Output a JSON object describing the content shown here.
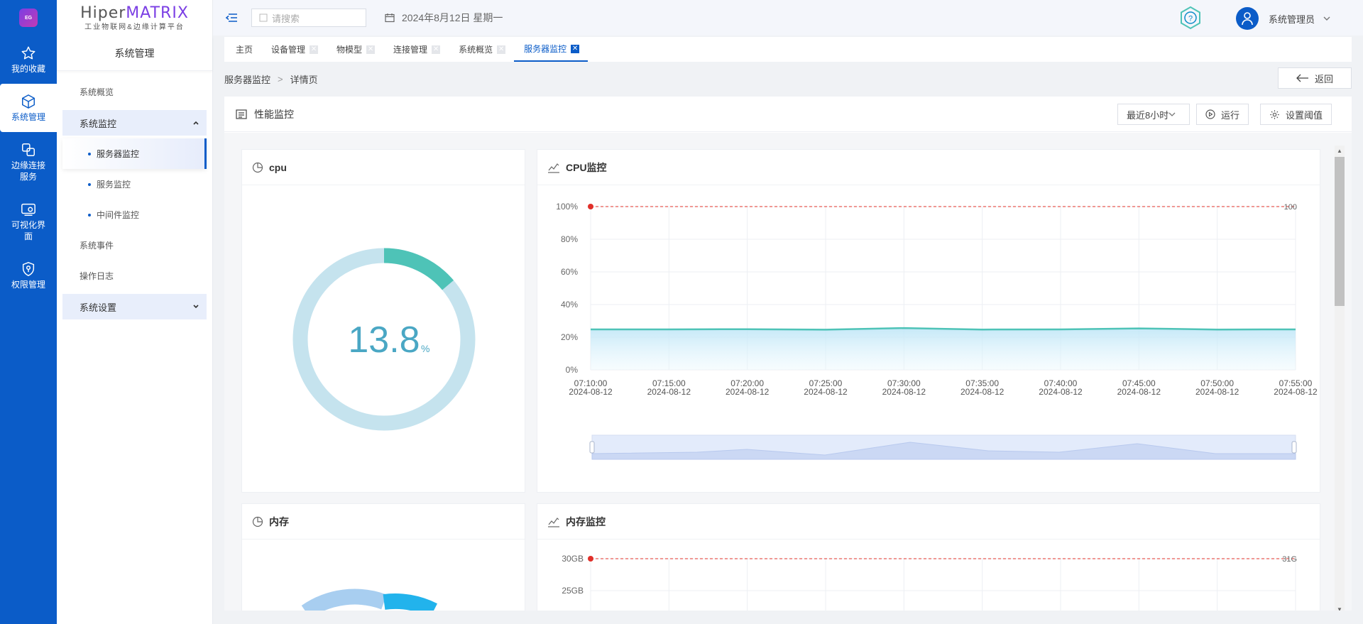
{
  "rail": {
    "logo_text": "EG",
    "items": [
      {
        "label": "我的收藏",
        "icon": "star-icon"
      },
      {
        "label": "系统管理",
        "icon": "cube-icon"
      },
      {
        "label": "边缘连接服务",
        "icon": "link-icon"
      },
      {
        "label": "可视化界面",
        "icon": "screen-icon"
      },
      {
        "label": "权限管理",
        "icon": "shield-icon"
      }
    ]
  },
  "brand": {
    "name_left": "Hiper",
    "name_right": "MATRIX",
    "subtitle": "工业物联网&边缘计算平台"
  },
  "side": {
    "title": "系统管理",
    "item_overview": "系统概览",
    "group_monitor": "系统监控",
    "sub_items": [
      "服务器监控",
      "服务监控",
      "中间件监控"
    ],
    "item_events": "系统事件",
    "item_logs": "操作日志",
    "group_settings": "系统设置"
  },
  "topbar": {
    "search_placeholder": "请搜索",
    "date": "2024年8月12日 星期一",
    "user": "系统管理员"
  },
  "tabs": [
    {
      "label": "主页",
      "closable": false
    },
    {
      "label": "设备管理",
      "closable": true
    },
    {
      "label": "物模型",
      "closable": true
    },
    {
      "label": "连接管理",
      "closable": true
    },
    {
      "label": "系统概览",
      "closable": true
    },
    {
      "label": "服务器监控",
      "closable": true,
      "active": true
    }
  ],
  "breadcrumb": {
    "parent": "服务器监控",
    "separator": ">",
    "current": "详情页",
    "back": "返回"
  },
  "panel": {
    "title": "性能监控",
    "range": "最近8小时",
    "run": "运行",
    "threshold": "设置阈值"
  },
  "cpu_card": {
    "title": "cpu",
    "value": "13.8",
    "unit": "%",
    "percent": 13.8
  },
  "memory_card": {
    "title": "内存"
  },
  "colors": {
    "accent": "#0b5cc8",
    "teal": "#4ec3b7",
    "ring_bg": "#c5e3ee",
    "threshold": "#e0302a",
    "value_text": "#4aa7c4"
  },
  "chart_data": [
    {
      "type": "area",
      "title": "CPU监控",
      "y_tick_labels": [
        "0%",
        "20%",
        "40%",
        "60%",
        "80%",
        "100%"
      ],
      "ylim": [
        0,
        100
      ],
      "x": [
        "07:10:00",
        "07:15:00",
        "07:20:00",
        "07:25:00",
        "07:30:00",
        "07:35:00",
        "07:40:00",
        "07:45:00",
        "07:50:00",
        "07:55:00"
      ],
      "x_sublabel": "2024-08-12",
      "series": [
        {
          "values": [
            24.8,
            24.8,
            24.9,
            24.6,
            25.6,
            24.7,
            24.8,
            25.4,
            24.7,
            24.8
          ]
        }
      ],
      "threshold": {
        "value": 100,
        "label": "100"
      },
      "grid": true,
      "data_zoom": true
    },
    {
      "type": "area",
      "title": "内存监控",
      "y_tick_labels": [
        "25GB",
        "30GB"
      ],
      "threshold": {
        "value": 31,
        "label": "31G"
      },
      "grid": true
    }
  ]
}
